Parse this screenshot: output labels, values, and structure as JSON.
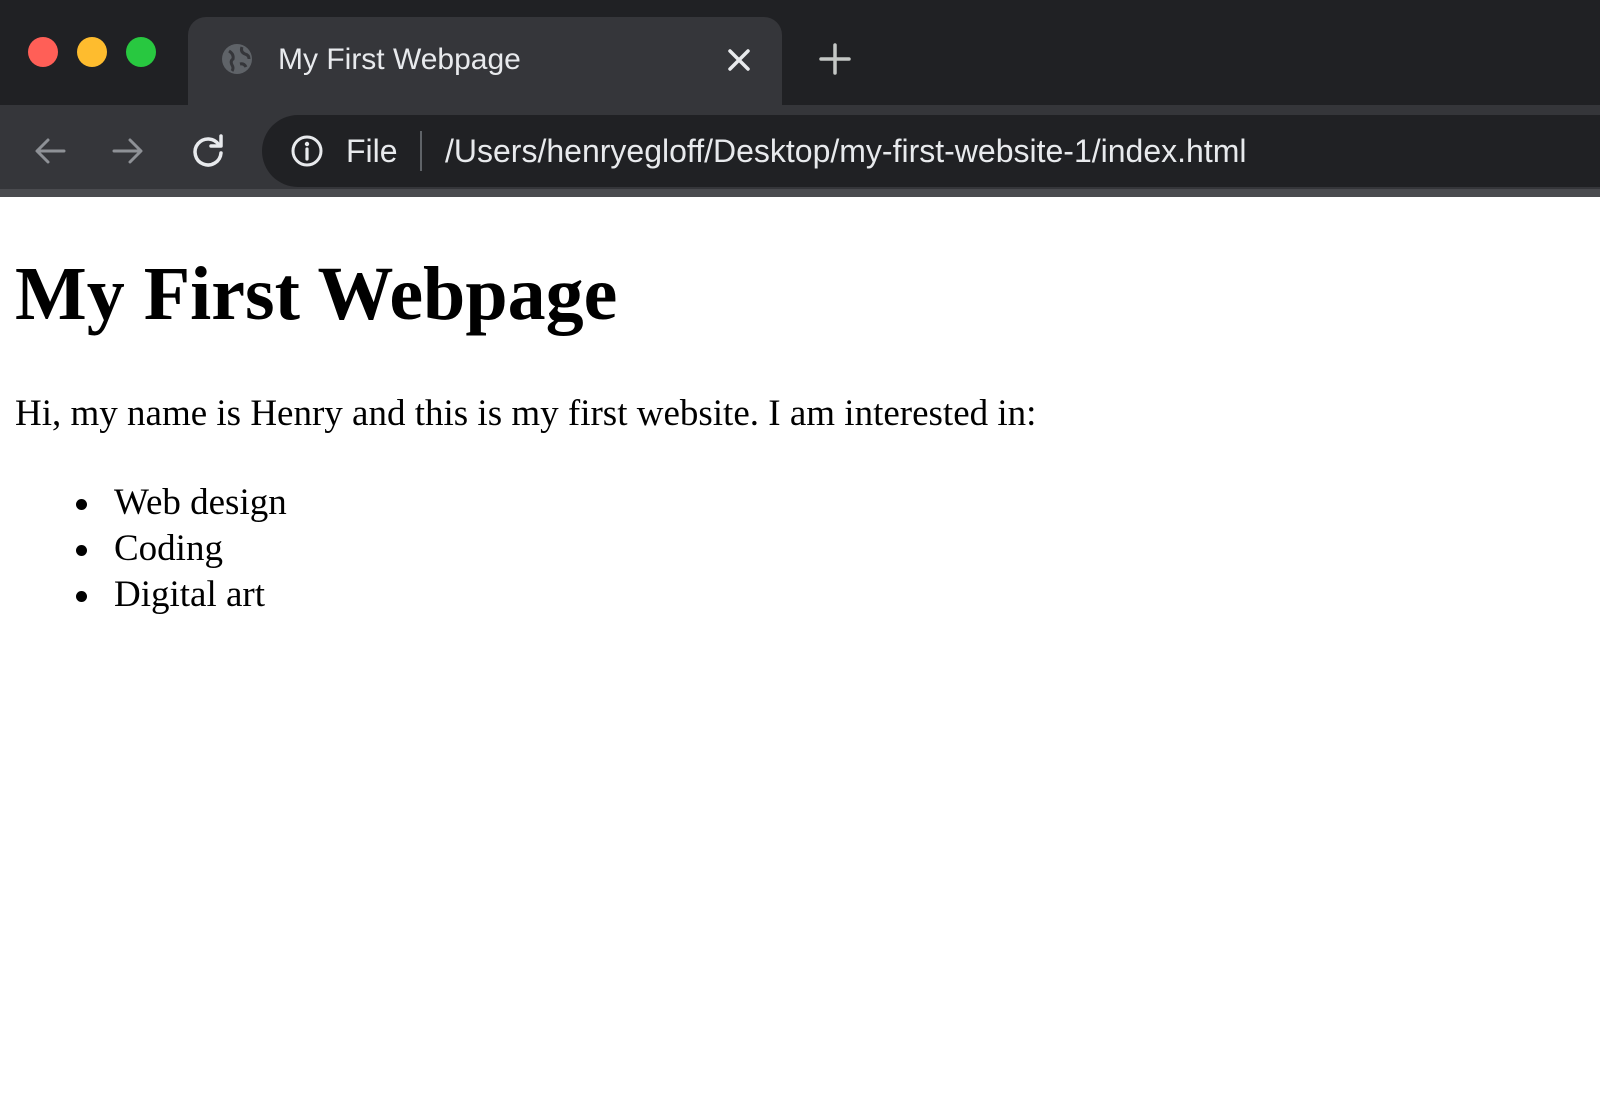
{
  "browser": {
    "tab": {
      "title": "My First Webpage"
    },
    "address_bar": {
      "scheme_label": "File",
      "url": "/Users/henryegloff/Desktop/my-first-website-1/index.html"
    },
    "colors": {
      "close": "#ff5f57",
      "minimize": "#febc2e",
      "zoom": "#28c840"
    },
    "icons": [
      "globe-icon",
      "close-icon",
      "plus-icon",
      "arrow-left-icon",
      "arrow-right-icon",
      "reload-icon",
      "info-icon"
    ]
  },
  "page": {
    "heading": "My First Webpage",
    "intro": "Hi, my name is Henry and this is my first website. I am interested in:",
    "interests": [
      "Web design",
      "Coding",
      "Digital art"
    ]
  }
}
